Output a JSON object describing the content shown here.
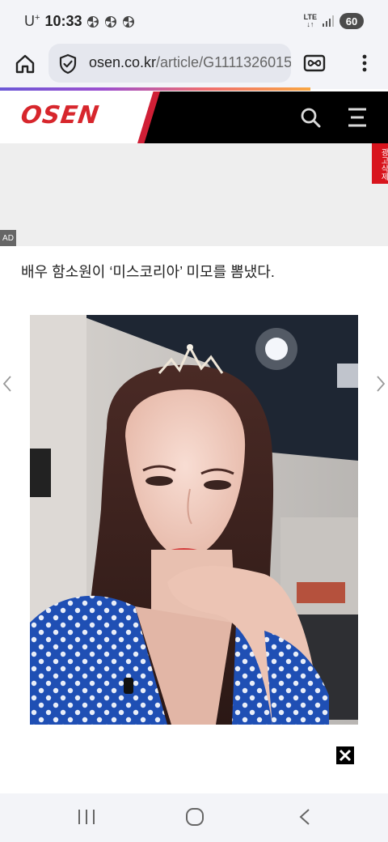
{
  "status_bar": {
    "carrier": "U",
    "carrier_sup": "+",
    "time": "10:33",
    "network": "LTE",
    "battery": "60",
    "notification_icons": [
      "pinwheel-icon",
      "pinwheel-icon",
      "pinwheel-icon"
    ]
  },
  "browser": {
    "url_domain": "osen.co.kr",
    "url_path": "/article/G1111326015",
    "page_load_progress": 0.8
  },
  "site": {
    "logo": "OSEN",
    "brand_color": "#d7262c",
    "accent_color": "#d01f36"
  },
  "ad": {
    "remove_label": "광고삭제",
    "label": "AD"
  },
  "article": {
    "lead": "배우 함소원이 ‘미스코리아’ 미모를 뽐냈다."
  },
  "colors": {
    "header_bg": "#000000",
    "chrome_bg": "#f3f4f8",
    "ad_bg": "#eeeeee"
  }
}
